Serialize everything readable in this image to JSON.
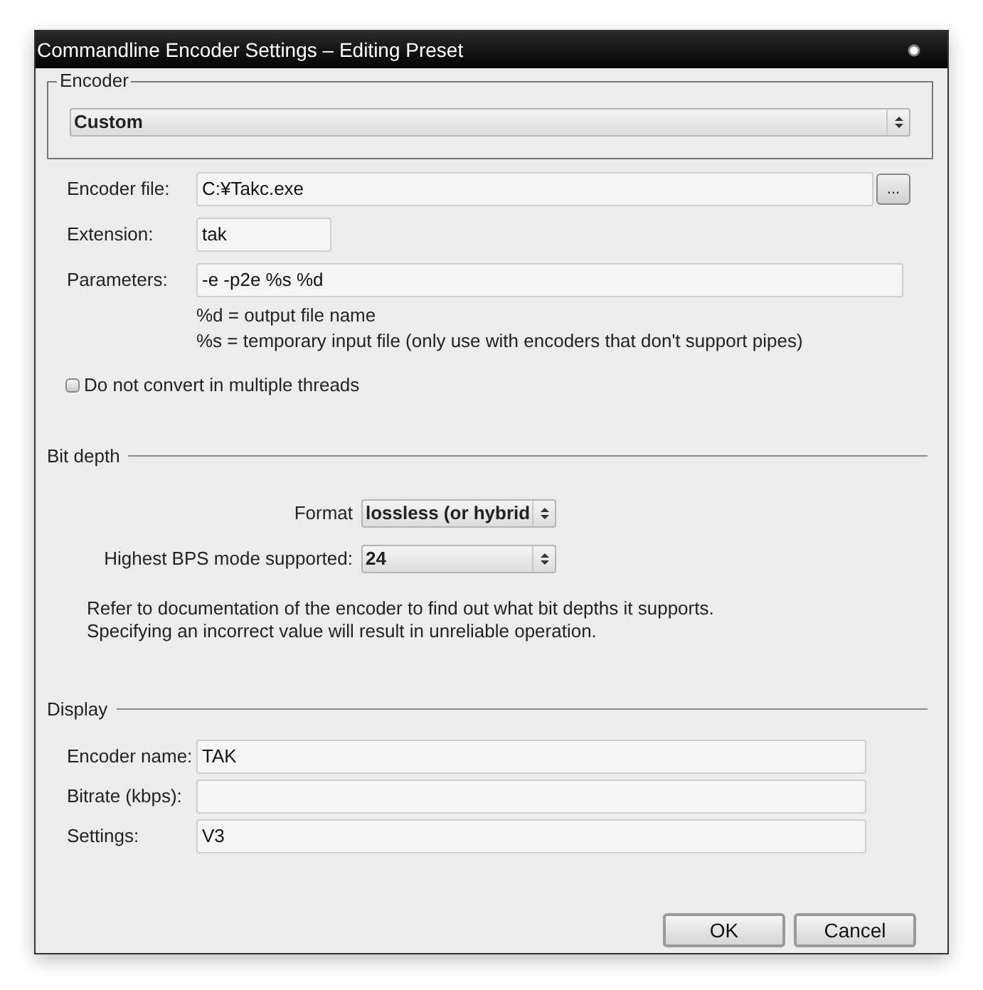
{
  "window": {
    "title": "Commandline Encoder Settings – Editing Preset"
  },
  "encoder_group": {
    "title": "Encoder",
    "select_value": "Custom"
  },
  "encoder_file": {
    "label": "Encoder file:",
    "value": "C:¥Takc.exe",
    "browse_label": "..."
  },
  "extension": {
    "label": "Extension:",
    "value": "tak"
  },
  "parameters": {
    "label": "Parameters:",
    "value": "-e -p2e %s %d"
  },
  "hints": [
    "%d = output file name",
    "%s = temporary input file (only use with encoders that don't support pipes)"
  ],
  "single_thread": {
    "label": "Do not convert in multiple threads",
    "checked": false
  },
  "bit_depth": {
    "title": "Bit depth",
    "format_label": "Format",
    "format_value": "lossless (or hybrid",
    "bps_label": "Highest BPS mode supported:",
    "bps_value": "24",
    "notes": [
      "Refer to documentation of the encoder to find out what bit depths it supports.",
      "Specifying an incorrect value will result in unreliable operation."
    ]
  },
  "display": {
    "title": "Display",
    "fields": [
      {
        "label": "Encoder name:",
        "value": "TAK"
      },
      {
        "label": "Bitrate (kbps):"
      },
      {
        "label": "Settings:",
        "value": "V3"
      }
    ]
  },
  "buttons": [
    "OK",
    "Cancel"
  ]
}
